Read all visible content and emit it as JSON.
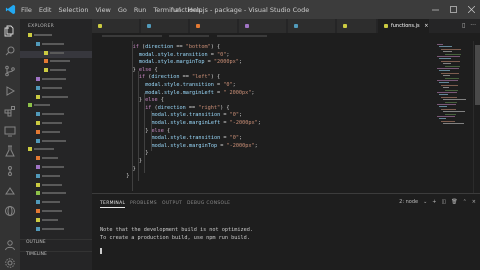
{
  "titlebar": {
    "menu": [
      "File",
      "Edit",
      "Selection",
      "View",
      "Go",
      "Run",
      "Terminal",
      "Help"
    ],
    "title": "functions.js - package - Visual Studio Code"
  },
  "sidebar": {
    "header": "EXPLORER",
    "sections": [
      "OUTLINE",
      "TIMELINE"
    ]
  },
  "tabs": [
    {
      "label": "functions.js",
      "active": true
    }
  ],
  "editor": {
    "lines": [
      {
        "n": "",
        "indent": 4,
        "tokens": [
          [
            "kw",
            "if"
          ],
          [
            "pn",
            " ("
          ],
          [
            "vr",
            "direction"
          ],
          [
            "pn",
            " == "
          ],
          [
            "str",
            "\"bottom\""
          ],
          [
            "pn",
            ") {"
          ]
        ]
      },
      {
        "n": "",
        "indent": 6,
        "tokens": [
          [
            "vr",
            "modal"
          ],
          [
            "pn",
            "."
          ],
          [
            "prop",
            "style"
          ],
          [
            "pn",
            "."
          ],
          [
            "prop",
            "transition"
          ],
          [
            "pn",
            " = "
          ],
          [
            "str",
            "\"0\""
          ],
          [
            "pn",
            ";"
          ]
        ]
      },
      {
        "n": "",
        "indent": 6,
        "tokens": [
          [
            "vr",
            "modal"
          ],
          [
            "pn",
            "."
          ],
          [
            "prop",
            "style"
          ],
          [
            "pn",
            "."
          ],
          [
            "prop",
            "marginTop"
          ],
          [
            "pn",
            " = "
          ],
          [
            "str",
            "\"2000px\""
          ],
          [
            "pn",
            ";"
          ]
        ]
      },
      {
        "n": "",
        "indent": 4,
        "tokens": [
          [
            "pn",
            "} "
          ],
          [
            "kw",
            "else"
          ],
          [
            "pn",
            " {"
          ]
        ]
      },
      {
        "n": "",
        "indent": 6,
        "tokens": [
          [
            "kw",
            "if"
          ],
          [
            "pn",
            " ("
          ],
          [
            "vr",
            "direction"
          ],
          [
            "pn",
            " == "
          ],
          [
            "str",
            "\"left\""
          ],
          [
            "pn",
            ") {"
          ]
        ]
      },
      {
        "n": "",
        "indent": 8,
        "tokens": [
          [
            "vr",
            "modal"
          ],
          [
            "pn",
            "."
          ],
          [
            "prop",
            "style"
          ],
          [
            "pn",
            "."
          ],
          [
            "prop",
            "transition"
          ],
          [
            "pn",
            " = "
          ],
          [
            "str",
            "\"0\""
          ],
          [
            "pn",
            ";"
          ]
        ]
      },
      {
        "n": "",
        "indent": 8,
        "tokens": [
          [
            "vr",
            "modal"
          ],
          [
            "pn",
            "."
          ],
          [
            "prop",
            "style"
          ],
          [
            "pn",
            "."
          ],
          [
            "prop",
            "marginLeft"
          ],
          [
            "pn",
            " = "
          ],
          [
            "str",
            "\" 2000px\""
          ],
          [
            "pn",
            ";"
          ]
        ]
      },
      {
        "n": "",
        "indent": 6,
        "tokens": [
          [
            "pn",
            "} "
          ],
          [
            "kw",
            "else"
          ],
          [
            "pn",
            " {"
          ]
        ]
      },
      {
        "n": "",
        "indent": 8,
        "tokens": [
          [
            "kw",
            "if"
          ],
          [
            "pn",
            " ("
          ],
          [
            "vr",
            "direction"
          ],
          [
            "pn",
            " == "
          ],
          [
            "str",
            "\"right\""
          ],
          [
            "pn",
            ") {"
          ]
        ]
      },
      {
        "n": "",
        "indent": 10,
        "tokens": [
          [
            "vr",
            "modal"
          ],
          [
            "pn",
            "."
          ],
          [
            "prop",
            "style"
          ],
          [
            "pn",
            "."
          ],
          [
            "prop",
            "transition"
          ],
          [
            "pn",
            " = "
          ],
          [
            "str",
            "\"0\""
          ],
          [
            "pn",
            ";"
          ]
        ]
      },
      {
        "n": "",
        "indent": 10,
        "tokens": [
          [
            "vr",
            "modal"
          ],
          [
            "pn",
            "."
          ],
          [
            "prop",
            "style"
          ],
          [
            "pn",
            "."
          ],
          [
            "prop",
            "marginLeft"
          ],
          [
            "pn",
            " = "
          ],
          [
            "str",
            "\"-2000px\""
          ],
          [
            "pn",
            ";"
          ]
        ]
      },
      {
        "n": "",
        "indent": 8,
        "tokens": [
          [
            "pn",
            "} "
          ],
          [
            "kw",
            "else"
          ],
          [
            "pn",
            " {"
          ]
        ]
      },
      {
        "n": "",
        "indent": 10,
        "tokens": [
          [
            "vr",
            "modal"
          ],
          [
            "pn",
            "."
          ],
          [
            "prop",
            "style"
          ],
          [
            "pn",
            "."
          ],
          [
            "prop",
            "transition"
          ],
          [
            "pn",
            " = "
          ],
          [
            "str",
            "\"0\""
          ],
          [
            "pn",
            ";"
          ]
        ]
      },
      {
        "n": "",
        "indent": 10,
        "tokens": [
          [
            "vr",
            "modal"
          ],
          [
            "pn",
            "."
          ],
          [
            "prop",
            "style"
          ],
          [
            "pn",
            "."
          ],
          [
            "prop",
            "marginTop"
          ],
          [
            "pn",
            " = "
          ],
          [
            "str",
            "\"-2000px\""
          ],
          [
            "pn",
            ";"
          ]
        ]
      },
      {
        "n": "",
        "indent": 8,
        "tokens": [
          [
            "pn",
            "}"
          ]
        ]
      },
      {
        "n": "",
        "indent": 6,
        "tokens": [
          [
            "pn",
            "}"
          ]
        ]
      },
      {
        "n": "",
        "indent": 4,
        "tokens": [
          [
            "pn",
            "}"
          ]
        ]
      },
      {
        "n": "",
        "indent": 2,
        "tokens": [
          [
            "pn",
            "}"
          ]
        ]
      }
    ]
  },
  "panel": {
    "tabs": [
      "TERMINAL",
      "PROBLEMS",
      "OUTPUT",
      "DEBUG CONSOLE"
    ],
    "shell": "2: node",
    "output": [
      "Note that the development build is not optimized.",
      "To create a production build, use npm run build."
    ]
  },
  "colors": {
    "keyword": "#c586c0",
    "string": "#ce9178",
    "property": "#9cdcfe",
    "titlebar": "#3c3c3c",
    "activitybar": "#333333",
    "sidebar": "#252526",
    "editor": "#1e1e1e"
  }
}
